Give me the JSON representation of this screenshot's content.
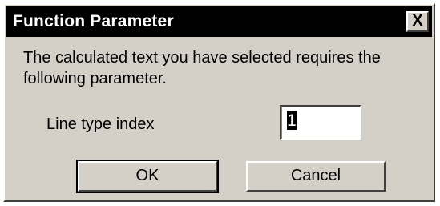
{
  "window": {
    "title": "Function Parameter",
    "close_label": "X"
  },
  "message": {
    "text": "The calculated text you have selected requires the following parameter."
  },
  "parameter": {
    "label": "Line type index",
    "value": "1"
  },
  "buttons": {
    "ok_label": "OK",
    "cancel_label": "Cancel"
  },
  "colors": {
    "titlebar": "#000000",
    "dialog_face": "#d4d0c8"
  }
}
